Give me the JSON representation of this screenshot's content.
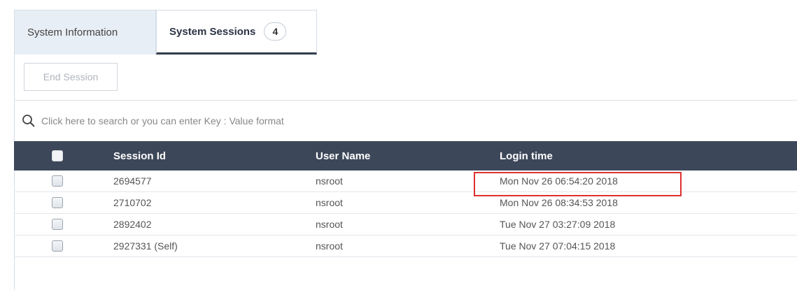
{
  "tabs": [
    {
      "label": "System Information"
    },
    {
      "label": "System Sessions",
      "count": "4"
    }
  ],
  "toolbar": {
    "end_session_label": "End Session"
  },
  "search": {
    "placeholder": "Click here to search or you can enter Key : Value format"
  },
  "table": {
    "headers": {
      "session_id": "Session Id",
      "user_name": "User Name",
      "login_time": "Login time"
    },
    "rows": [
      {
        "session_id": "2694577",
        "user_name": "nsroot",
        "login_time": "Mon Nov 26 06:54:20 2018"
      },
      {
        "session_id": "2710702",
        "user_name": "nsroot",
        "login_time": "Mon Nov 26 08:34:53 2018"
      },
      {
        "session_id": "2892402",
        "user_name": "nsroot",
        "login_time": "Tue Nov 27 03:27:09 2018"
      },
      {
        "session_id": "2927331 (Self)",
        "user_name": "nsroot",
        "login_time": "Tue Nov 27 07:04:15 2018"
      }
    ]
  },
  "colors": {
    "header_bg": "#3c4759",
    "highlight": "#e0302f",
    "active_tab_underline": "#2f3b4c"
  }
}
